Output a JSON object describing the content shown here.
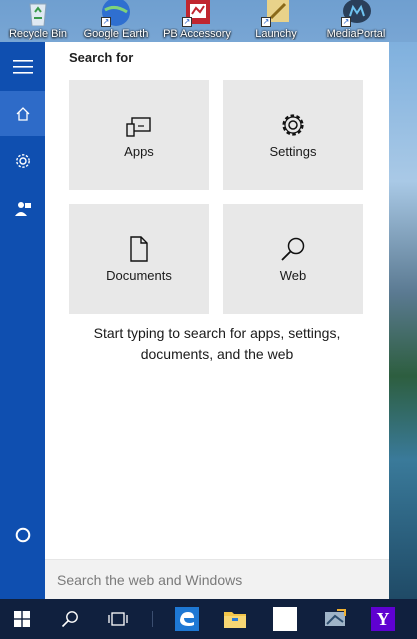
{
  "desktop": {
    "icons": [
      {
        "label": "Recycle Bin"
      },
      {
        "label": "Google Earth"
      },
      {
        "label": "PB Accessory"
      },
      {
        "label": "Launchy"
      },
      {
        "label": "MediaPortal"
      }
    ]
  },
  "rail": {
    "items": [
      {
        "name": "menu",
        "icon": "hamburger-icon"
      },
      {
        "name": "home",
        "icon": "home-icon",
        "active": true
      },
      {
        "name": "settings",
        "icon": "gear-icon"
      },
      {
        "name": "feedback",
        "icon": "feedback-icon"
      },
      {
        "name": "cortana",
        "icon": "circle-icon"
      }
    ]
  },
  "search_pane": {
    "title": "Search for",
    "tiles": [
      {
        "label": "Apps",
        "icon": "apps-icon"
      },
      {
        "label": "Settings",
        "icon": "gear-icon"
      },
      {
        "label": "Documents",
        "icon": "document-icon"
      },
      {
        "label": "Web",
        "icon": "search-icon"
      }
    ],
    "hint_line1": "Start typing to search for apps, settings,",
    "hint_line2": "documents, and the web",
    "search_placeholder": "Search the web and Windows"
  },
  "taskbar": {
    "items": [
      {
        "name": "start",
        "icon": "windows-logo-icon"
      },
      {
        "name": "search",
        "icon": "search-icon"
      },
      {
        "name": "task-view",
        "icon": "task-view-icon"
      },
      {
        "name": "edge",
        "icon": "edge-icon"
      },
      {
        "name": "file-explorer",
        "icon": "folder-icon"
      },
      {
        "name": "blank-app",
        "icon": "blank-window-icon"
      },
      {
        "name": "app",
        "icon": "app-icon"
      },
      {
        "name": "yahoo",
        "icon": "yahoo-icon",
        "glyph": "Y"
      }
    ]
  },
  "colors": {
    "rail": "#0f4fb0",
    "rail_active": "#2e6bc8",
    "tile": "#e8e8e8",
    "taskbar": "#10203e"
  }
}
